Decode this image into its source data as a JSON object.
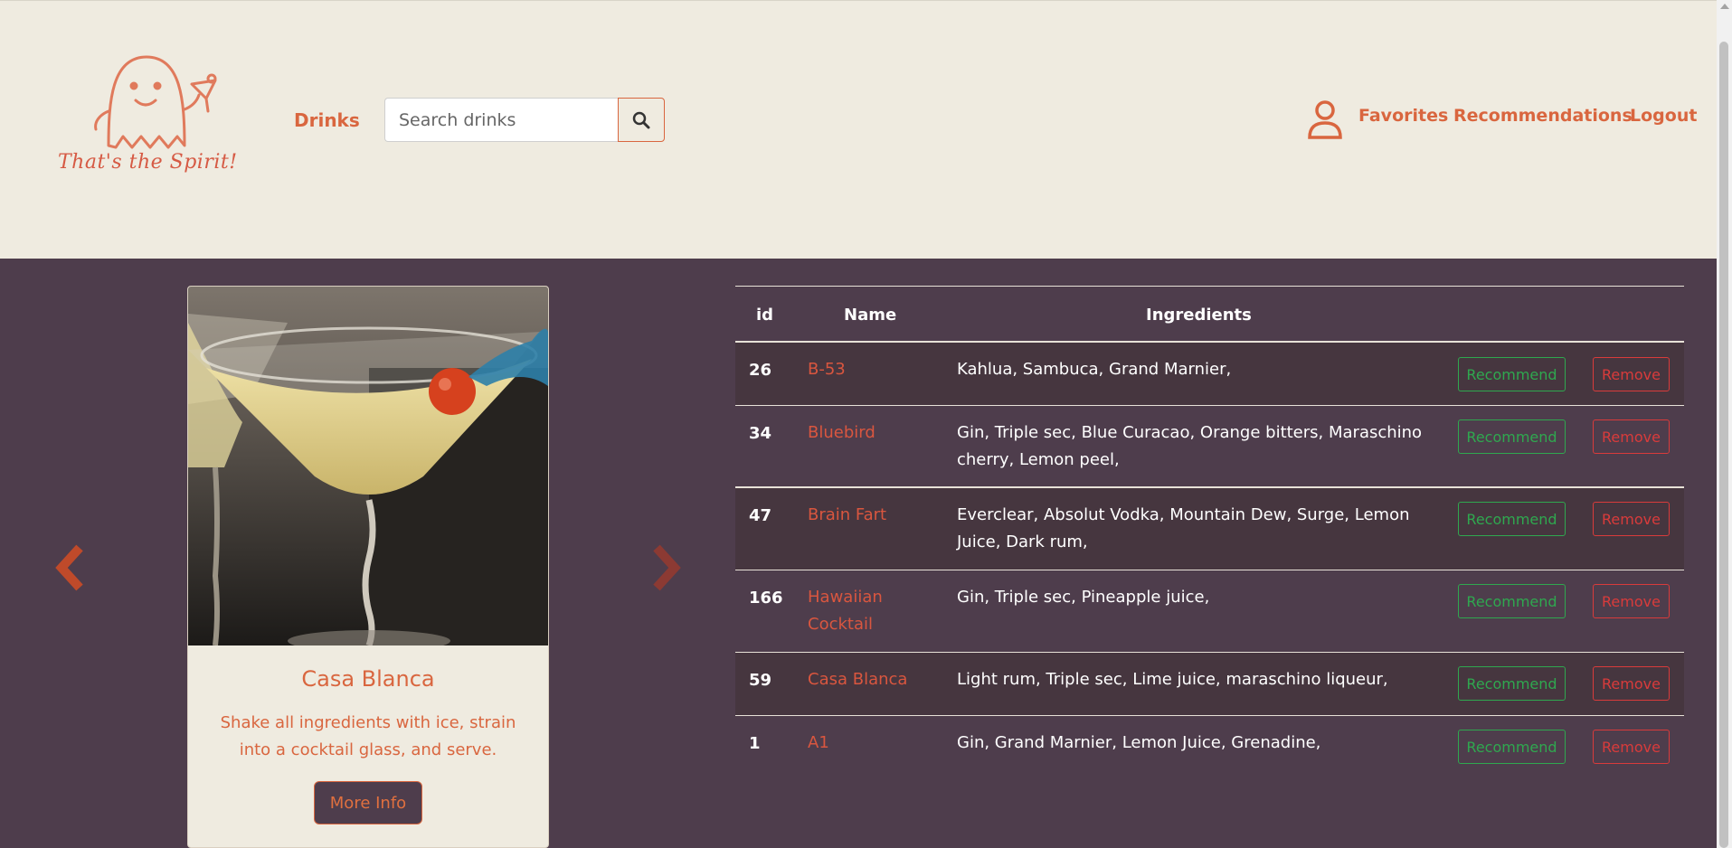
{
  "header": {
    "logo_text": "That's the Spirit!",
    "nav_drinks": "Drinks",
    "search": {
      "placeholder": "Search drinks",
      "value": ""
    },
    "links": {
      "favorites": "Favorites",
      "recommendations": "Recommendations",
      "logout": "Logout"
    }
  },
  "carousel": {
    "title": "Casa Blanca",
    "description": "Shake all ingredients with ice, strain into a cocktail glass, and serve.",
    "button_label": "More Info"
  },
  "table": {
    "headers": {
      "id": "id",
      "name": "Name",
      "ingredients": "Ingredients"
    },
    "recommend_label": "Recommend",
    "remove_label": "Remove",
    "rows": [
      {
        "id": "26",
        "name": "B-53",
        "ingredients": "Kahlua, Sambuca, Grand Marnier,"
      },
      {
        "id": "34",
        "name": "Bluebird",
        "ingredients": "Gin, Triple sec, Blue Curacao, Orange bitters, Maraschino cherry, Lemon peel,"
      },
      {
        "id": "47",
        "name": "Brain Fart",
        "ingredients": "Everclear, Absolut Vodka, Mountain Dew, Surge, Lemon Juice, Dark rum,"
      },
      {
        "id": "166",
        "name": "Hawaiian Cocktail",
        "ingredients": "Gin, Triple sec, Pineapple juice,"
      },
      {
        "id": "59",
        "name": "Casa Blanca",
        "ingredients": "Light rum, Triple sec, Lime juice, maraschino liqueur,"
      },
      {
        "id": "1",
        "name": "A1",
        "ingredients": "Gin, Grand Marnier, Lemon Juice, Grenadine,"
      }
    ]
  },
  "colors": {
    "accent": "#d9663f",
    "header_bg": "#efebe0",
    "body_bg": "#4e3d4c",
    "success": "#2fa84f",
    "danger": "#d93b3b"
  },
  "icons": [
    "ghost-logo-icon",
    "search-icon",
    "user-icon",
    "chevron-left-icon",
    "chevron-right-icon"
  ]
}
